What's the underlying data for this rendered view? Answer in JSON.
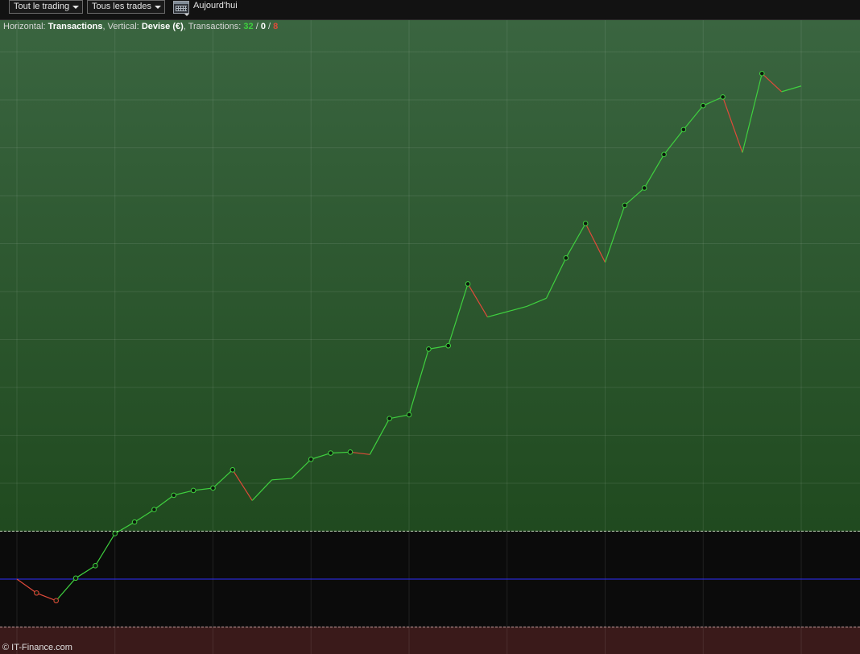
{
  "toolbar": {
    "trading_dropdown": "Tout le trading",
    "trades_dropdown": "Tous les trades",
    "calendar_icon": "calendar-icon",
    "today_label": "Aujourd'hui"
  },
  "info": {
    "horizontal_label": "Horizontal:",
    "horizontal_value": "Transactions",
    "vertical_label": ", Vertical:",
    "vertical_value": "Devise (€)",
    "transactions_label": ", Transactions:",
    "wins": "32",
    "sep1": " / ",
    "breakeven": "0",
    "sep2": " / ",
    "losses": "8"
  },
  "footer": {
    "copyright": "© IT-Finance.com"
  },
  "colors": {
    "win_line": "#3fd03f",
    "loss_line": "#e04a3a",
    "zero_line": "#2f2fff",
    "upper_zone": "#2c5a2c",
    "lower_zone": "#3a1a1a",
    "background": "#0b0b0b"
  },
  "chart_data": {
    "type": "line",
    "title": "",
    "xlabel": "Transactions",
    "ylabel": "Devise (€)",
    "grid": true,
    "x": [
      0,
      1,
      2,
      3,
      4,
      5,
      6,
      7,
      8,
      9,
      10,
      11,
      12,
      13,
      14,
      15,
      16,
      17,
      18,
      19,
      20,
      21,
      22,
      23,
      24,
      25,
      26,
      27,
      28,
      29,
      30,
      31,
      32,
      33,
      34,
      35,
      36,
      37,
      38,
      39,
      40
    ],
    "y": [
      0,
      -0.29,
      -0.45,
      0.02,
      0.28,
      0.95,
      1.19,
      1.45,
      1.75,
      1.85,
      1.9,
      2.28,
      1.64,
      2.07,
      2.1,
      2.5,
      2.63,
      2.65,
      2.6,
      3.35,
      3.43,
      4.8,
      4.87,
      6.16,
      5.47,
      5.58,
      5.69,
      5.86,
      6.7,
      7.42,
      6.61,
      7.8,
      8.16,
      8.86,
      9.38,
      9.88,
      10.06,
      8.9,
      10.55,
      10.17,
      10.29
    ],
    "trade_results": [
      "loss",
      "loss",
      "win",
      "win",
      "win",
      "win",
      "win",
      "win",
      "win",
      "win",
      "win",
      "loss",
      "win",
      "win",
      "win",
      "win",
      "win",
      "loss",
      "win",
      "win",
      "win",
      "win",
      "win",
      "loss",
      "win",
      "win",
      "win",
      "win",
      "win",
      "loss",
      "win",
      "win",
      "win",
      "win",
      "win",
      "win",
      "loss",
      "win",
      "loss",
      "win"
    ],
    "markers": [
      false,
      true,
      true,
      true,
      true,
      true,
      true,
      true,
      true,
      true,
      true,
      true,
      false,
      false,
      false,
      true,
      true,
      true,
      false,
      true,
      true,
      true,
      true,
      true,
      false,
      false,
      false,
      false,
      true,
      true,
      false,
      true,
      true,
      true,
      true,
      true,
      true,
      false,
      true,
      false,
      false
    ],
    "ylim": [
      -1.5,
      11.6
    ],
    "upper_threshold": 1.0,
    "lower_threshold": -1.0,
    "zero_line": 0
  }
}
